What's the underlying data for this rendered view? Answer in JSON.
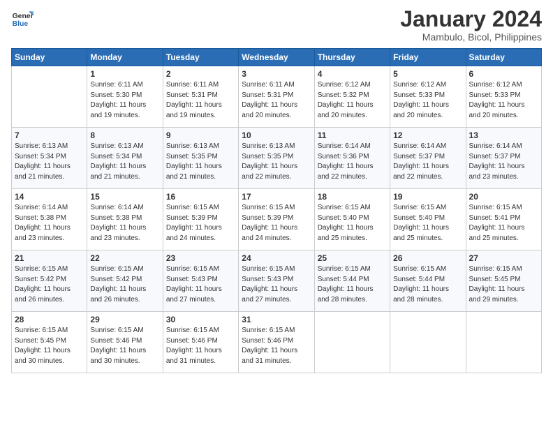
{
  "logo": {
    "line1": "General",
    "line2": "Blue"
  },
  "title": "January 2024",
  "location": "Mambulo, Bicol, Philippines",
  "days_of_week": [
    "Sunday",
    "Monday",
    "Tuesday",
    "Wednesday",
    "Thursday",
    "Friday",
    "Saturday"
  ],
  "weeks": [
    [
      {
        "day": "",
        "detail": ""
      },
      {
        "day": "1",
        "detail": "Sunrise: 6:11 AM\nSunset: 5:30 PM\nDaylight: 11 hours\nand 19 minutes."
      },
      {
        "day": "2",
        "detail": "Sunrise: 6:11 AM\nSunset: 5:31 PM\nDaylight: 11 hours\nand 19 minutes."
      },
      {
        "day": "3",
        "detail": "Sunrise: 6:11 AM\nSunset: 5:31 PM\nDaylight: 11 hours\nand 20 minutes."
      },
      {
        "day": "4",
        "detail": "Sunrise: 6:12 AM\nSunset: 5:32 PM\nDaylight: 11 hours\nand 20 minutes."
      },
      {
        "day": "5",
        "detail": "Sunrise: 6:12 AM\nSunset: 5:33 PM\nDaylight: 11 hours\nand 20 minutes."
      },
      {
        "day": "6",
        "detail": "Sunrise: 6:12 AM\nSunset: 5:33 PM\nDaylight: 11 hours\nand 20 minutes."
      }
    ],
    [
      {
        "day": "7",
        "detail": "Sunrise: 6:13 AM\nSunset: 5:34 PM\nDaylight: 11 hours\nand 21 minutes."
      },
      {
        "day": "8",
        "detail": "Sunrise: 6:13 AM\nSunset: 5:34 PM\nDaylight: 11 hours\nand 21 minutes."
      },
      {
        "day": "9",
        "detail": "Sunrise: 6:13 AM\nSunset: 5:35 PM\nDaylight: 11 hours\nand 21 minutes."
      },
      {
        "day": "10",
        "detail": "Sunrise: 6:13 AM\nSunset: 5:35 PM\nDaylight: 11 hours\nand 22 minutes."
      },
      {
        "day": "11",
        "detail": "Sunrise: 6:14 AM\nSunset: 5:36 PM\nDaylight: 11 hours\nand 22 minutes."
      },
      {
        "day": "12",
        "detail": "Sunrise: 6:14 AM\nSunset: 5:37 PM\nDaylight: 11 hours\nand 22 minutes."
      },
      {
        "day": "13",
        "detail": "Sunrise: 6:14 AM\nSunset: 5:37 PM\nDaylight: 11 hours\nand 23 minutes."
      }
    ],
    [
      {
        "day": "14",
        "detail": "Sunrise: 6:14 AM\nSunset: 5:38 PM\nDaylight: 11 hours\nand 23 minutes."
      },
      {
        "day": "15",
        "detail": "Sunrise: 6:14 AM\nSunset: 5:38 PM\nDaylight: 11 hours\nand 23 minutes."
      },
      {
        "day": "16",
        "detail": "Sunrise: 6:15 AM\nSunset: 5:39 PM\nDaylight: 11 hours\nand 24 minutes."
      },
      {
        "day": "17",
        "detail": "Sunrise: 6:15 AM\nSunset: 5:39 PM\nDaylight: 11 hours\nand 24 minutes."
      },
      {
        "day": "18",
        "detail": "Sunrise: 6:15 AM\nSunset: 5:40 PM\nDaylight: 11 hours\nand 25 minutes."
      },
      {
        "day": "19",
        "detail": "Sunrise: 6:15 AM\nSunset: 5:40 PM\nDaylight: 11 hours\nand 25 minutes."
      },
      {
        "day": "20",
        "detail": "Sunrise: 6:15 AM\nSunset: 5:41 PM\nDaylight: 11 hours\nand 25 minutes."
      }
    ],
    [
      {
        "day": "21",
        "detail": "Sunrise: 6:15 AM\nSunset: 5:42 PM\nDaylight: 11 hours\nand 26 minutes."
      },
      {
        "day": "22",
        "detail": "Sunrise: 6:15 AM\nSunset: 5:42 PM\nDaylight: 11 hours\nand 26 minutes."
      },
      {
        "day": "23",
        "detail": "Sunrise: 6:15 AM\nSunset: 5:43 PM\nDaylight: 11 hours\nand 27 minutes."
      },
      {
        "day": "24",
        "detail": "Sunrise: 6:15 AM\nSunset: 5:43 PM\nDaylight: 11 hours\nand 27 minutes."
      },
      {
        "day": "25",
        "detail": "Sunrise: 6:15 AM\nSunset: 5:44 PM\nDaylight: 11 hours\nand 28 minutes."
      },
      {
        "day": "26",
        "detail": "Sunrise: 6:15 AM\nSunset: 5:44 PM\nDaylight: 11 hours\nand 28 minutes."
      },
      {
        "day": "27",
        "detail": "Sunrise: 6:15 AM\nSunset: 5:45 PM\nDaylight: 11 hours\nand 29 minutes."
      }
    ],
    [
      {
        "day": "28",
        "detail": "Sunrise: 6:15 AM\nSunset: 5:45 PM\nDaylight: 11 hours\nand 30 minutes."
      },
      {
        "day": "29",
        "detail": "Sunrise: 6:15 AM\nSunset: 5:46 PM\nDaylight: 11 hours\nand 30 minutes."
      },
      {
        "day": "30",
        "detail": "Sunrise: 6:15 AM\nSunset: 5:46 PM\nDaylight: 11 hours\nand 31 minutes."
      },
      {
        "day": "31",
        "detail": "Sunrise: 6:15 AM\nSunset: 5:46 PM\nDaylight: 11 hours\nand 31 minutes."
      },
      {
        "day": "",
        "detail": ""
      },
      {
        "day": "",
        "detail": ""
      },
      {
        "day": "",
        "detail": ""
      }
    ]
  ]
}
